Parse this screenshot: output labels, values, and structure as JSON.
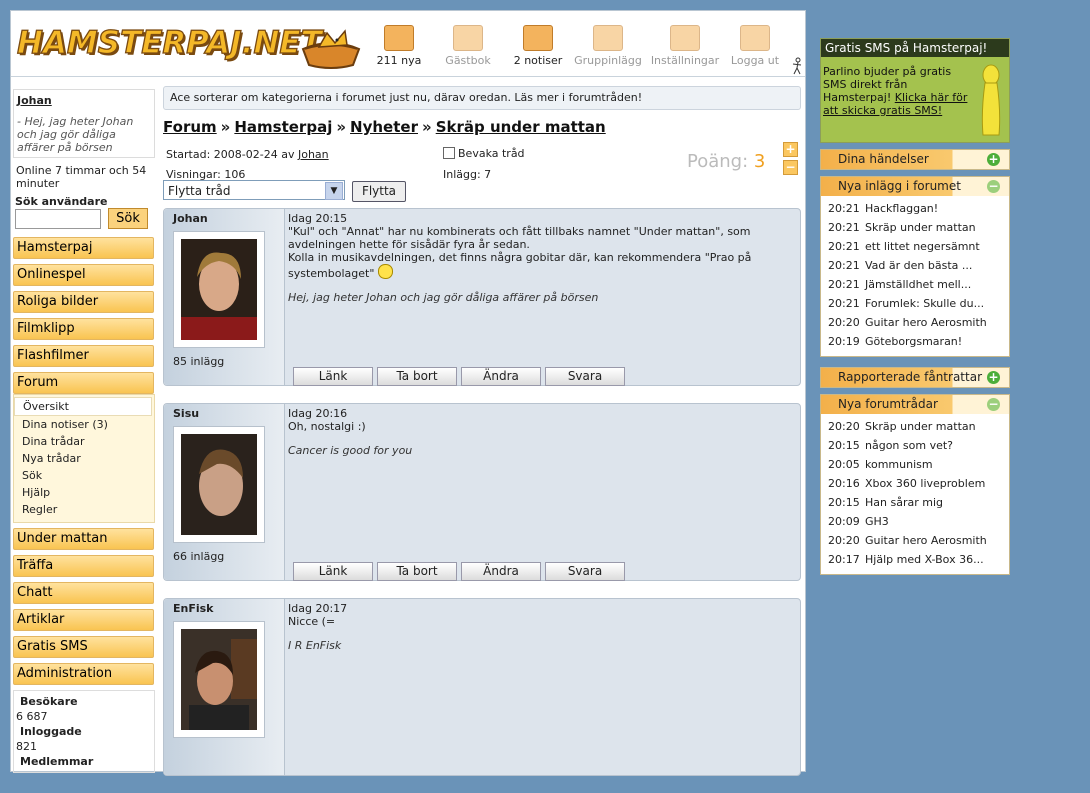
{
  "header": {
    "logo_text": "HAMSTERPAJ.NET",
    "icons": [
      {
        "label": "211 nya",
        "icon": "mail-icon"
      },
      {
        "label": "Gästbok",
        "icon": "guestbook-icon"
      },
      {
        "label": "2 notiser",
        "icon": "notice-icon"
      },
      {
        "label": "Gruppinlägg",
        "icon": "group-icon"
      },
      {
        "label": "Inställningar",
        "icon": "settings-icon"
      },
      {
        "label": "Logga ut",
        "icon": "logout-icon"
      }
    ]
  },
  "left": {
    "username": "Johan",
    "presentation": "- Hej, jag heter Johan och jag gör dåliga affärer på börsen",
    "online": "Online 7 timmar och 54 minuter",
    "search_label": "Sök användare",
    "search_button": "Sök",
    "menu": [
      "Hamsterpaj",
      "Onlinespel",
      "Roliga bilder",
      "Filmklipp",
      "Flashfilmer",
      "Forum"
    ],
    "forum_sub": [
      "Översikt",
      "Dina notiser (3)",
      "Dina trådar",
      "Nya trådar",
      "Sök",
      "Hjälp",
      "Regler"
    ],
    "menu2": [
      "Under mattan",
      "Träffa",
      "Chatt",
      "Artiklar",
      "Gratis SMS",
      "Administration"
    ],
    "stats": {
      "visitors_label": "Besökare",
      "visitors": "6 687",
      "logged_label": "Inloggade",
      "logged": "821",
      "members_label": "Medlemmar"
    }
  },
  "main": {
    "notice": "Ace sorterar om kategorierna i forumet just nu, därav oredan. Läs mer i ",
    "notice_link": "forumtråden!",
    "crumbs": [
      "Forum",
      "Hamsterpaj",
      "Nyheter",
      "Skräp under mattan"
    ],
    "crumb_sep": "»",
    "started": "Startad: 2008-02-24 av ",
    "started_by": "Johan",
    "views": "Visningar: 106",
    "watch": "Bevaka tråd",
    "posts_count": "Inlägg: 7",
    "points_label": "Poäng:",
    "points": "3",
    "move_select": "Flytta tråd",
    "move_button": "Flytta",
    "post_buttons": [
      "Länk",
      "Ta bort",
      "Ändra",
      "Svara"
    ],
    "posts": [
      {
        "author": "Johan",
        "time": "Idag 20:15",
        "text": "\"Kul\" och \"Annat\" har nu kombinerats och fått tillbaks namnet \"Under mattan\", som avdelningen hette för sisådär fyra år sedan.\nKolla in musikavdelningen, det finns några gobitar där, kan rekommendera \"Prao på systembolaget\"",
        "signature": "Hej, jag heter Johan och jag gör dåliga affärer på börsen",
        "count": "85 inlägg"
      },
      {
        "author": "Sisu",
        "time": "Idag 20:16",
        "text": "Oh, nostalgi :)",
        "signature": "Cancer is good for you",
        "count": "66 inlägg"
      },
      {
        "author": "EnFisk",
        "time": "Idag 20:17",
        "text": "Nicce (=",
        "signature": "I R EnFisk",
        "count": ""
      }
    ]
  },
  "right": {
    "sms_title": "Gratis SMS på Hamsterpaj!",
    "sms_text": "Parlino bjuder på gratis SMS direkt från Hamsterpaj! ",
    "sms_link": "Klicka här för att skicka gratis SMS!",
    "box_events": "Dina händelser",
    "box_new_posts": "Nya inlägg i forumet",
    "new_posts": [
      {
        "time": "20:21",
        "title": "Hackflaggan!"
      },
      {
        "time": "20:21",
        "title": "Skräp under mattan"
      },
      {
        "time": "20:21",
        "title": "ett littet negersämnt"
      },
      {
        "time": "20:21",
        "title": "Vad är den bästa ..."
      },
      {
        "time": "20:21",
        "title": "Jämställdhet mell..."
      },
      {
        "time": "20:21",
        "title": "Forumlek: Skulle du..."
      },
      {
        "time": "20:20",
        "title": "Guitar hero Aerosmith"
      },
      {
        "time": "20:19",
        "title": "Göteborgsmaran!"
      }
    ],
    "box_reported": "Rapporterade fåntrattar",
    "box_new_threads": "Nya forumtrådar",
    "new_threads": [
      {
        "time": "20:20",
        "title": "Skräp under mattan"
      },
      {
        "time": "20:15",
        "title": "någon som vet?"
      },
      {
        "time": "20:05",
        "title": "kommunism"
      },
      {
        "time": "20:16",
        "title": "Xbox 360 liveproblem"
      },
      {
        "time": "20:15",
        "title": "Han sårar mig"
      },
      {
        "time": "20:09",
        "title": "GH3"
      },
      {
        "time": "20:20",
        "title": "Guitar hero Aerosmith"
      },
      {
        "time": "20:17",
        "title": "Hjälp med X-Box 36..."
      }
    ]
  }
}
